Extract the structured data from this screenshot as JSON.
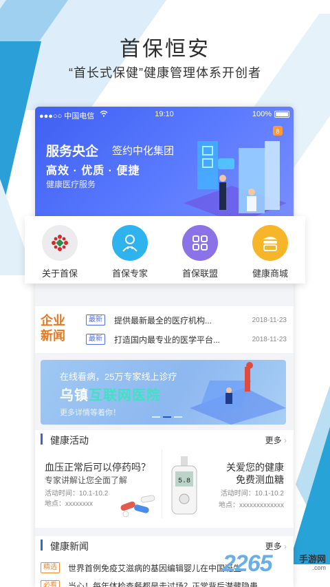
{
  "hero": {
    "title": "首保恒安",
    "subtitle": "“首长式保健”健康管理体系开创者"
  },
  "statusbar": {
    "carrier": "●●●○○ 中国电信",
    "time": "19:10",
    "battery": "100%"
  },
  "banner": {
    "title": "服务央企",
    "title2": "签约中化集团",
    "line2": "高效 · 优质 · 便捷",
    "line3": "健康医疗服务",
    "badge": "8"
  },
  "menu": [
    {
      "label": "关于首保",
      "icon": "logo-icon",
      "color": "#e8e8ea"
    },
    {
      "label": "首保专家",
      "icon": "doctor-icon",
      "color": "#2fb3ee"
    },
    {
      "label": "首保联盟",
      "icon": "grid-icon",
      "color": "#8b72e6"
    },
    {
      "label": "健康商城",
      "icon": "shop-icon",
      "color": "#f7b52a"
    }
  ],
  "news": {
    "logo": "企业\n新闻",
    "logo_line1": "企业",
    "logo_line2": "新闻",
    "items": [
      {
        "tag": "最新",
        "text": "提供最新最全的医疗机构...",
        "date": "2018-11-23"
      },
      {
        "tag": "最新",
        "text": "打造国内最专业的医学平台...",
        "date": "2018-11-23"
      }
    ]
  },
  "promo": {
    "line1": "在线看病，25万专家线上诊疗",
    "line2a": "乌镇",
    "line2b": "互联网医院",
    "line3": "更多详情等着你！"
  },
  "activity": {
    "title": "健康活动",
    "more": "更多",
    "left": {
      "question": "血压正常后可以停药吗？",
      "sub": "专家讲解让您全面了解",
      "time": "活动时间：10.1-10.2",
      "place": "地点：xxxxxxxx"
    },
    "right": {
      "line1": "关爱您的健康",
      "line2": "免费测血糖",
      "time": "活动时间：10.1-10.2",
      "place": "地点：xxxxxxxxxxxxx",
      "meter_value": "5.8"
    }
  },
  "health_news": {
    "title": "健康新闻",
    "more": "更多",
    "items": [
      {
        "tag": "精选",
        "text": "世界首例免疫艾滋病的基因编辑婴儿在中国诞生"
      },
      {
        "tag": "必看",
        "text": "当心！每年体检查餐都是走过场？正常背后潜藏隐患"
      }
    ]
  },
  "watermark": {
    "number": "2265",
    "suffix": ".com",
    "text": "手游网"
  },
  "colors": {
    "accent_blue": "#3c5fe8",
    "orange": "#e8761d",
    "banner_bg": "#4a69f5"
  }
}
